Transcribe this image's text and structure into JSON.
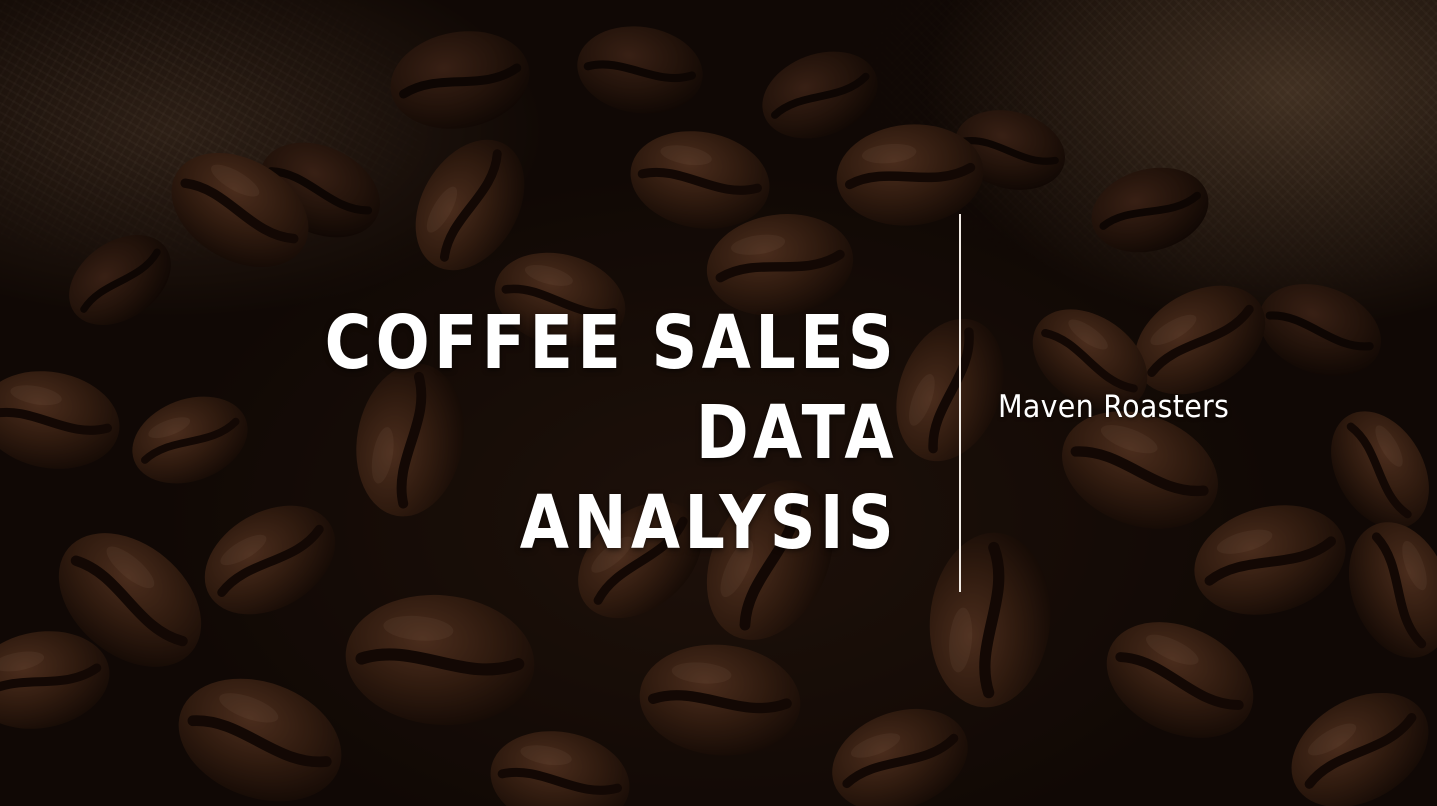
{
  "slide": {
    "title_line_1": "COFFEE SALES DATA",
    "title_line_2": "ANALYSIS",
    "subtitle": "Maven Roasters",
    "background_image": "coffee-beans-on-burlap",
    "text_color": "#ffffff",
    "divider_color": "#f2ece6"
  }
}
